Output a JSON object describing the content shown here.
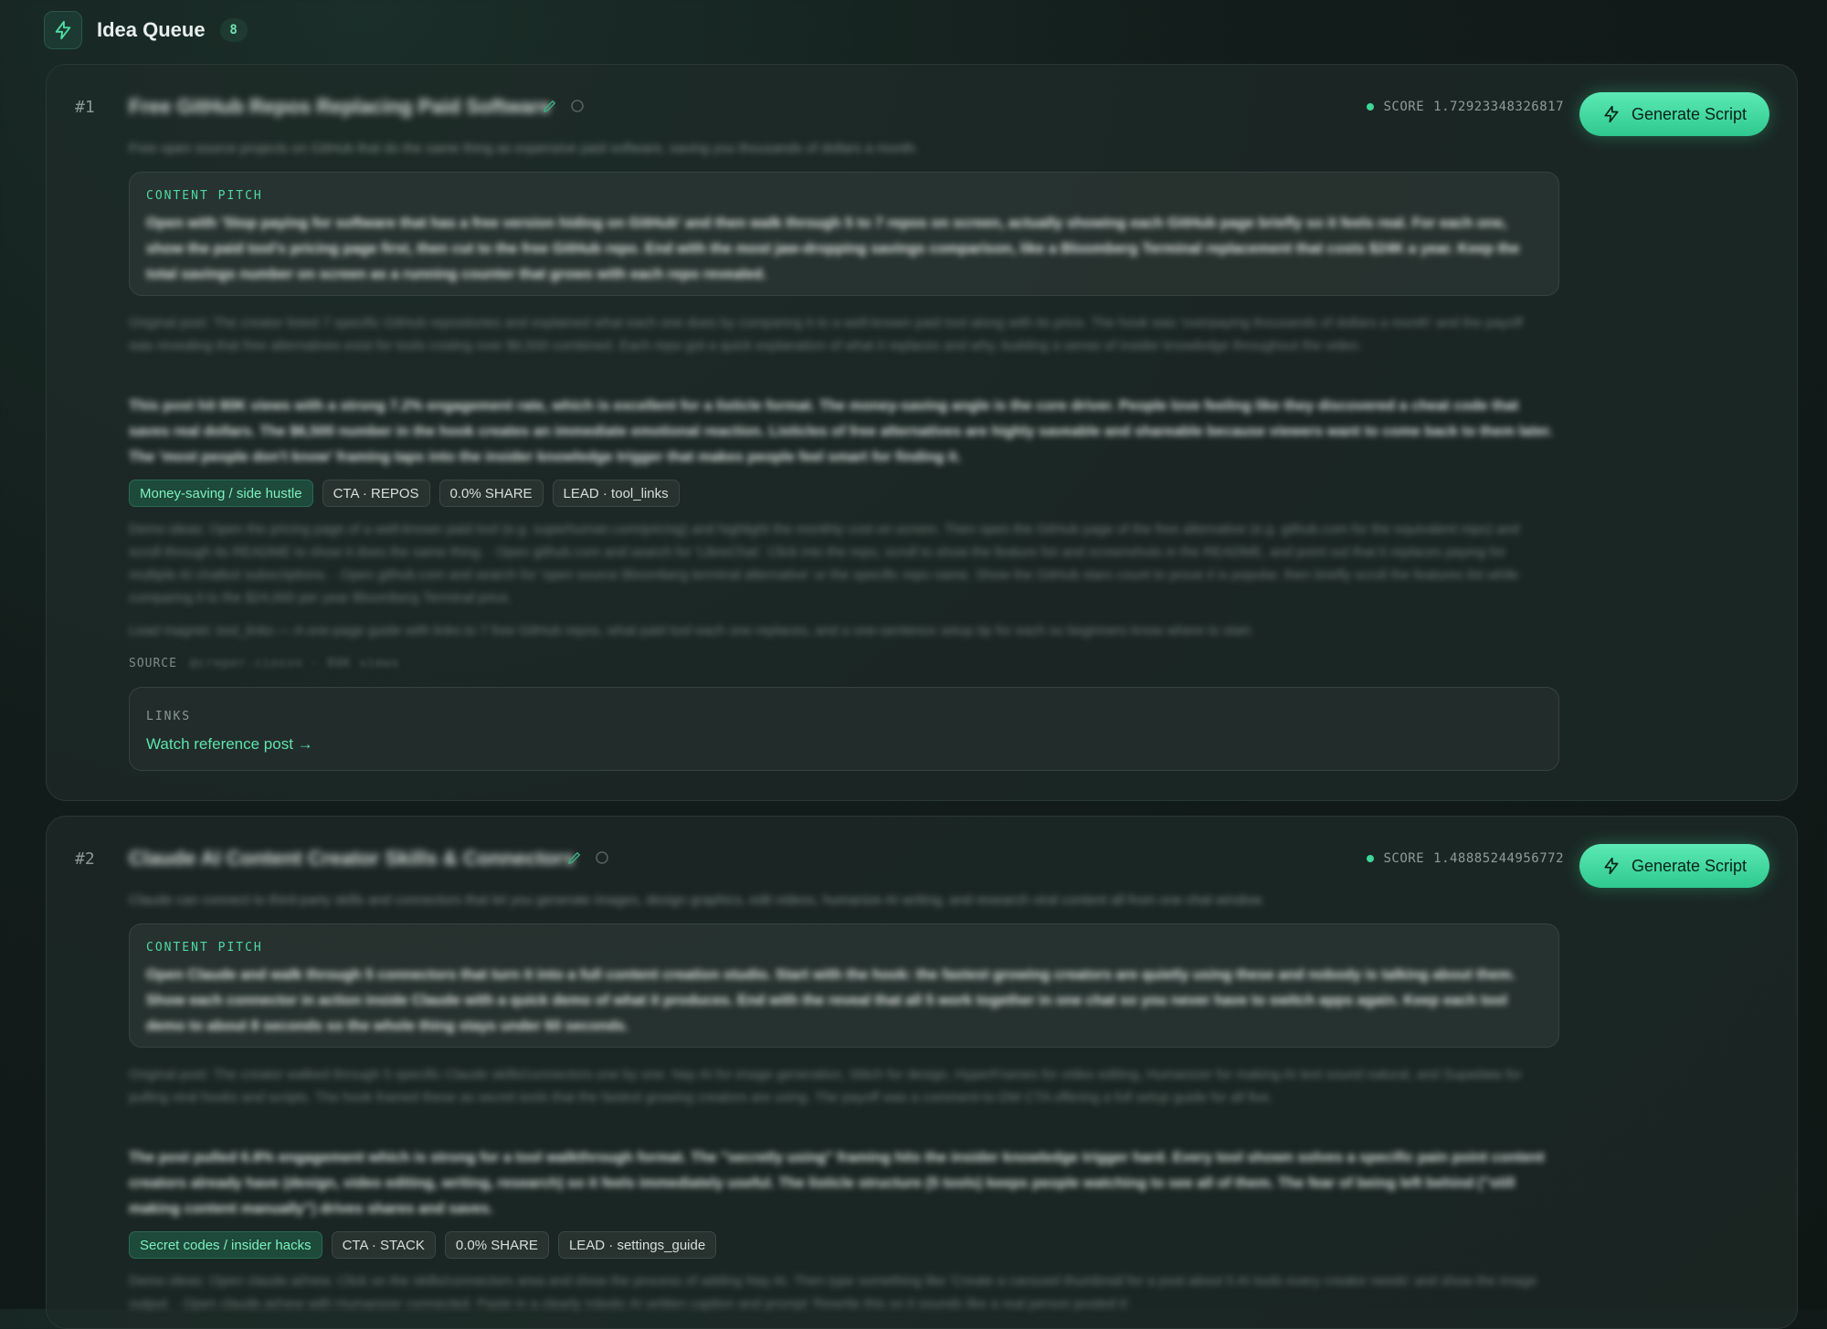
{
  "header": {
    "title": "Idea Queue",
    "count": "8"
  },
  "ideas": [
    {
      "rank": "#1",
      "title": "Free GitHub Repos Replacing Paid Software",
      "score_label": "SCORE",
      "score": "1.72923348326817",
      "generate_label": "Generate Script",
      "summary": "Free open source projects on GitHub that do the same thing as expensive paid software, saving you thousands of dollars a month.",
      "pitch_label": "CONTENT PITCH",
      "pitch": "Open with 'Stop paying for software that has a free version hiding on GitHub' and then walk through 5 to 7 repos on screen, actually showing each GitHub page briefly so it feels real. For each one, show the paid tool's pricing page first, then cut to the free GitHub repo. End with the most jaw-dropping savings comparison, like a Bloomberg Terminal replacement that costs $24K a year. Keep the total savings number on screen as a running counter that grows with each repo revealed.",
      "original": "Original post: The creator listed 7 specific GitHub repositories and explained what each one does by comparing it to a well-known paid tool along with its price. The hook was 'overpaying thousands of dollars a month' and the payoff was revealing that free alternatives exist for tools costing over $6,500 combined. Each repo got a quick explanation of what it replaces and why, building a sense of insider knowledge throughout the video.",
      "analysis": "This post hit 80K views with a strong 7.2% engagement rate, which is excellent for a listicle format. The money-saving angle is the core driver. People love feeling like they discovered a cheat code that saves real dollars. The $6,500 number in the hook creates an immediate emotional reaction. Listicles of free alternatives are highly saveable and shareable because viewers want to come back to them later. The 'most people don't know' framing taps into the insider knowledge trigger that makes people feel smart for finding it.",
      "tags": [
        "Money-saving / side hustle",
        "CTA · REPOS",
        "0.0% SHARE",
        "LEAD · tool_links"
      ],
      "demo": "Demo ideas: Open the pricing page of a well-known paid tool (e.g. superhuman.com/pricing) and highlight the monthly cost on screen. Then open the GitHub page of the free alternative (e.g. github.com for the equivalent repo) and scroll through its README to show it does the same thing. · Open github.com and search for 'LibreChat'. Click into the repo, scroll to show the feature list and screenshots in the README, and point out that it replaces paying for multiple AI chatbot subscriptions. · Open github.com and search for 'open source Bloomberg terminal alternative' or the specific repo name. Show the GitHub stars count to prove it is popular, then briefly scroll the features list while comparing it to the $24,000 per year Bloomberg Terminal price.",
      "lead": "Lead magnet: tool_links — A one-page guide with links to 7 free GitHub repos, what paid tool each one replaces, and a one-sentence setup tip for each so beginners know where to start.",
      "source_label": "SOURCE",
      "source_value": "@creper.ciossn · 80K views",
      "links_label": "LINKS",
      "link_text": "Watch reference post →"
    },
    {
      "rank": "#2",
      "title": "Claude AI Content Creator Skills & Connectors",
      "score_label": "SCORE",
      "score": "1.48885244956772",
      "generate_label": "Generate Script",
      "summary": "Claude can connect to third-party skills and connectors that let you generate images, design graphics, edit videos, humanize AI writing, and research viral content all from one chat window.",
      "pitch_label": "CONTENT PITCH",
      "pitch": "Open Claude and walk through 5 connectors that turn it into a full content creation studio. Start with the hook: the fastest growing creators are quietly using these and nobody is talking about them. Show each connector in action inside Claude with a quick demo of what it produces. End with the reveal that all 5 work together in one chat so you never have to switch apps again. Keep each tool demo to about 8 seconds so the whole thing stays under 60 seconds.",
      "original": "Original post: The creator walked through 5 specific Claude skills/connectors one by one: Nay AI for image generation, Stitch for design, HyperFrames for video editing, Humanizer for making AI text sound natural, and Supadata for pulling viral hooks and scripts. The hook framed these as secret tools that the fastest growing creators are using. The payoff was a comment-to-DM CTA offering a full setup guide for all five.",
      "analysis": "The post pulled 6.8% engagement which is strong for a tool walkthrough format. The \"secretly using\" framing hits the insider knowledge trigger hard. Every tool shown solves a specific pain point content creators already have (design, video editing, writing, research) so it feels immediately useful. The listicle structure (5 tools) keeps people watching to see all of them. The fear of being left behind (\"still making content manually\") drives shares and saves.",
      "tags": [
        "Secret codes / insider hacks",
        "CTA · STACK",
        "0.0% SHARE",
        "LEAD · settings_guide"
      ],
      "demo": "Demo ideas: Open claude.ai/new. Click on the skills/connectors area and show the process of adding Nay AI. Then type something like 'Create a carousel thumbnail for a post about 5 AI tools every creator needs' and show the image output. · Open claude.ai/new with Humanizer connected. Paste in a clearly robotic AI written caption and prompt 'Rewrite this so it sounds like a real person posted it'."
    }
  ]
}
